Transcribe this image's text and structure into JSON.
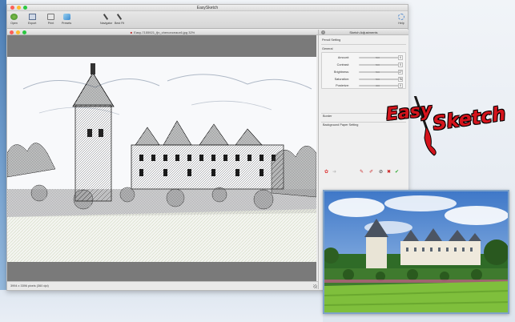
{
  "window": {
    "title": "EasySketch"
  },
  "toolbar": {
    "open": "Open",
    "export": "Export",
    "print": "Print",
    "presets": "Presets",
    "navigator": "Navigator",
    "best_fit": "Best Fit",
    "help": "Help"
  },
  "document": {
    "title": "Easy-7155921_fjn_chenonceaux6.jpg 32%",
    "status": "3994 x 3396 pixels (360 dpi)"
  },
  "panel": {
    "title": "Sketch Adjustments",
    "pencil_setting": "Pencil Setting",
    "general": "General",
    "sliders": [
      {
        "label": "Amount:",
        "mid": "500",
        "value": "0"
      },
      {
        "label": "Contrast:",
        "mid": "500",
        "value": "0"
      },
      {
        "label": "Brightness:",
        "mid": "500",
        "value": "27"
      },
      {
        "label": "Saturation:",
        "mid": "500",
        "value": "76"
      },
      {
        "label": "Posterize:",
        "mid": "300",
        "value": "0"
      }
    ],
    "border": "Border",
    "background_paper": "Background Paper Setting"
  },
  "logo": {
    "word1": "Easy",
    "word2": "Sketch"
  },
  "colors": {
    "accent_red": "#d4141c",
    "window_bg": "#ececec",
    "desktop_blue": "#4d7fb6"
  },
  "icons": [
    "open-icon",
    "export-icon",
    "print-icon",
    "presets-icon",
    "navigator-icon",
    "best-fit-icon",
    "help-icon"
  ]
}
